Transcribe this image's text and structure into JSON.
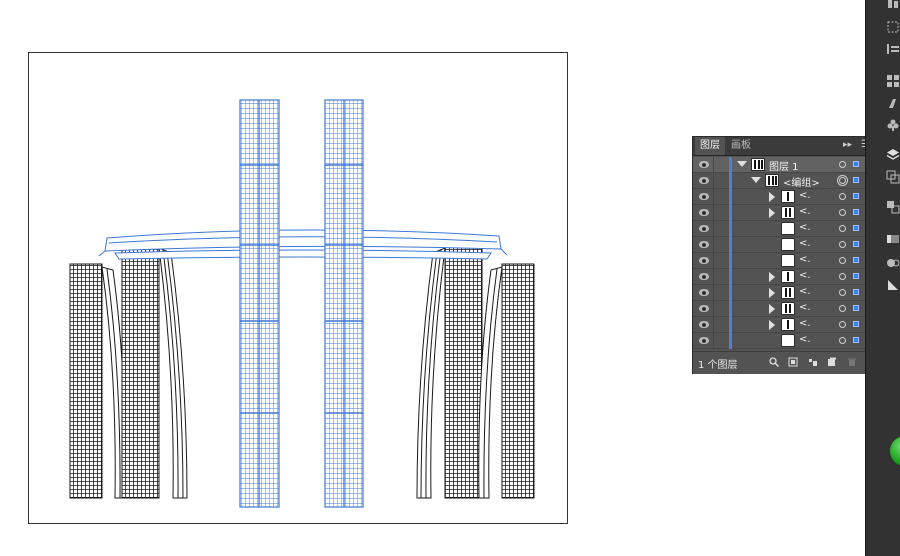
{
  "layers_panel": {
    "tabs": [
      "图层",
      "画板"
    ],
    "active_tab": "图层",
    "rows": [
      {
        "name": "图层 1",
        "kind": "layer",
        "expanded": true,
        "selected": true
      },
      {
        "name": "<编组>",
        "kind": "group",
        "expanded": true,
        "selected": false
      },
      {
        "name": "<.",
        "kind": "item",
        "expanded": false,
        "selected": false
      },
      {
        "name": "<.",
        "kind": "item",
        "expanded": false,
        "selected": false
      },
      {
        "name": "<.",
        "kind": "item",
        "expanded": null,
        "selected": false
      },
      {
        "name": "<.",
        "kind": "item",
        "expanded": null,
        "selected": false
      },
      {
        "name": "<.",
        "kind": "item",
        "expanded": null,
        "selected": false
      },
      {
        "name": "<.",
        "kind": "item",
        "expanded": false,
        "selected": false
      },
      {
        "name": "<.",
        "kind": "item",
        "expanded": false,
        "selected": false
      },
      {
        "name": "<.",
        "kind": "item",
        "expanded": false,
        "selected": false
      },
      {
        "name": "<.",
        "kind": "item",
        "expanded": false,
        "selected": false
      },
      {
        "name": "<.",
        "kind": "item",
        "expanded": null,
        "selected": false
      }
    ],
    "footer": {
      "layer_count": "1 个图层"
    },
    "icons": [
      "visibility-eye-icon",
      "search-icon",
      "collect-for-export-icon",
      "make-clipping-mask-icon",
      "new-layer-icon",
      "delete-icon"
    ],
    "layer_color": "#4f7fd9"
  },
  "toolstrip": {
    "icons": [
      "align-icon",
      "transform-icon",
      "libraries-icon",
      "brushes-icon",
      "symbols-icon",
      "layers-icon",
      "artboards-icon",
      "pathfinder-icon",
      "gradient-icon",
      "appearance-icon",
      "transparency-icon"
    ]
  },
  "canvas": {
    "selection_color": "#3d78d8",
    "artwork": "building-illustration"
  }
}
